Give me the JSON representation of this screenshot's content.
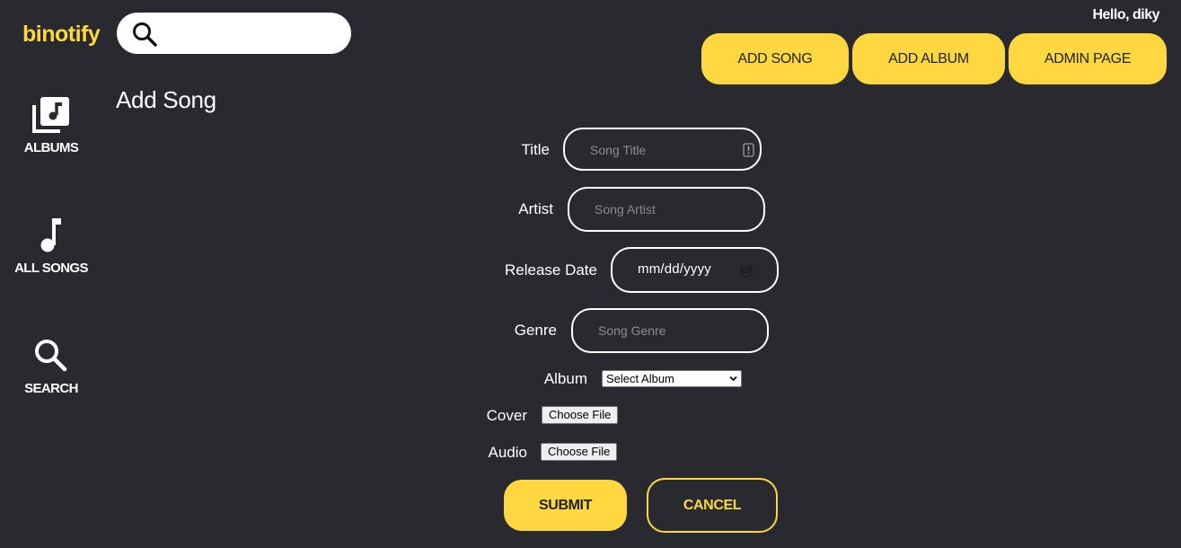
{
  "app": {
    "logo": "binotify",
    "accent_color": "#ffd740",
    "background_color": "#282a30"
  },
  "search": {
    "placeholder": "",
    "icon": "search-icon"
  },
  "sidebar": {
    "items": [
      {
        "label": "ALBUMS",
        "icon": "album-icon"
      },
      {
        "label": "ALL SONGS",
        "icon": "music-note-icon"
      },
      {
        "label": "SEARCH",
        "icon": "search-icon"
      }
    ]
  },
  "header": {
    "greeting": "Hello, diky",
    "buttons": [
      "ADD SONG",
      "ADD ALBUM",
      "ADMIN PAGE"
    ]
  },
  "page": {
    "title": "Add Song"
  },
  "form": {
    "title": {
      "label": "Title",
      "placeholder": "Song Title",
      "value": ""
    },
    "artist": {
      "label": "Artist",
      "placeholder": "Song Artist",
      "value": ""
    },
    "release_date": {
      "label": "Release Date",
      "value": "mm/dd/yyyy"
    },
    "genre": {
      "label": "Genre",
      "placeholder": "Song Genre",
      "value": ""
    },
    "album": {
      "label": "Album",
      "selected": "Select Album"
    },
    "cover": {
      "label": "Cover",
      "button": "Choose File"
    },
    "audio": {
      "label": "Audio",
      "button": "Choose File"
    },
    "submit": "SUBMIT",
    "cancel": "CANCEL"
  }
}
